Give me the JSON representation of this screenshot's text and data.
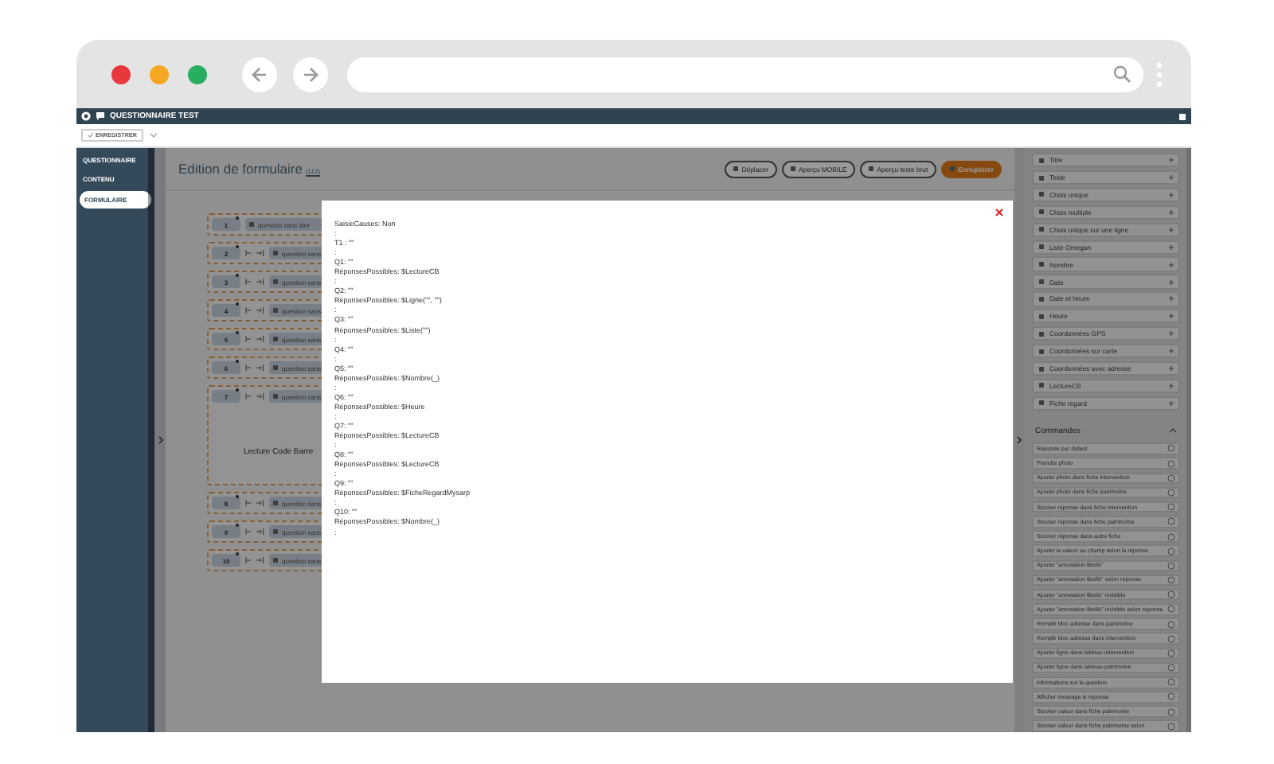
{
  "app_header": {
    "title": "QUESTIONNAIRE TEST"
  },
  "toolbar": {
    "save_label": "ENREGISTRER"
  },
  "sidebar": {
    "items": [
      {
        "label": "QUESTIONNAIRE",
        "selected": false
      },
      {
        "label": "CONTENU",
        "selected": false
      },
      {
        "label": "FORMULAIRE",
        "selected": true
      }
    ]
  },
  "editor": {
    "title": "Edition de formulaire",
    "count": "(112)",
    "buttons": [
      {
        "label": "Déplacer",
        "kind": "outline"
      },
      {
        "label": "Aperçu MOBILE",
        "kind": "outline"
      },
      {
        "label": "Aperçu texte brut",
        "kind": "outline"
      },
      {
        "label": "Enregistrer",
        "kind": "primary"
      }
    ],
    "questions": [
      {
        "number": "1",
        "label": "question sans titre",
        "kind": "title"
      },
      {
        "number": "2",
        "label": "question sans",
        "kind": "question"
      },
      {
        "number": "3",
        "label": "question sans",
        "kind": "question"
      },
      {
        "number": "4",
        "label": "question sans",
        "kind": "question"
      },
      {
        "number": "5",
        "label": "question sans",
        "kind": "question"
      },
      {
        "number": "6",
        "label": "question sans",
        "kind": "question"
      },
      {
        "number": "7",
        "label": "question sans",
        "kind": "barcode",
        "caption": "Lecture Code Barre"
      },
      {
        "number": "8",
        "label": "question sans",
        "kind": "question"
      },
      {
        "number": "9",
        "label": "question sans",
        "kind": "question"
      },
      {
        "number": "10",
        "label": "question sans",
        "kind": "question"
      }
    ]
  },
  "palette": {
    "items": [
      {
        "label": "Titre"
      },
      {
        "label": "Texte"
      },
      {
        "label": "Choix unique"
      },
      {
        "label": "Choix multiple"
      },
      {
        "label": "Choix unique sur une ligne"
      },
      {
        "label": "Liste Omegan"
      },
      {
        "label": "Nombre"
      },
      {
        "label": "Date"
      },
      {
        "label": "Date et heure"
      },
      {
        "label": "Heure"
      },
      {
        "label": "Coordonnées GPS"
      },
      {
        "label": "Coordonnées sur carte"
      },
      {
        "label": "Coordonnées avec adresse"
      },
      {
        "label": "LectureCB"
      },
      {
        "label": "Fiche regard"
      }
    ]
  },
  "commands": {
    "title": "Commandes",
    "items": [
      "Réponse par défaut",
      "Prendre photo",
      "Ajouter photo dans fiche intervention",
      "Ajouter photo dans fiche patrimoine",
      "Stocker réponse dans fiche intervention",
      "Stocker réponse dans fiche patrimoine",
      "Stocker réponse dans autre fiche",
      "Ajouter la valeur au champ selon la réponse",
      "Ajouter \"annotation libellé\"",
      "Ajouter \"annotation libellé\" selon réponse",
      "Ajouter \"annotation libellé\" invisible",
      "Ajouter \"annotation libellé\" invisible selon réponse",
      "Remplir bloc adresse dans patrimoine",
      "Remplir bloc adresse dans intervention",
      "Ajouter ligne dans tableau intervention",
      "Ajouter ligne dans tableau patrimoine",
      "Informations sur la question",
      "Afficher message si réponse",
      "Stocker valeur dans fiche patrimoine",
      "Stocker valeur dans fiche patrimoine selon"
    ]
  },
  "modal": {
    "lines": [
      "SaisieCauses: Non",
      ":",
      "T1 : \"\"",
      ":",
      "Q1: \"\"",
      "RéponsesPossibles: $LectureCB",
      ":",
      "Q2: \"\"",
      "RéponsesPossibles: $Ligne(\"\", \"\")",
      ":",
      "Q3: \"\"",
      "RéponsesPossibles: $Liste(\"\")",
      ":",
      "Q4: \"\"",
      ":",
      "Q5: \"\"",
      "RéponsesPossibles: $Nombre(_)",
      ":",
      "Q6: \"\"",
      "RéponsesPossibles: $Heure",
      ":",
      "Q7: \"\"",
      "RéponsesPossibles: $LectureCB",
      ":",
      "Q8: \"\"",
      "RéponsesPossibles: $LectureCB",
      ":",
      "Q9: \"\"",
      "RéponsesPossibles: $FicheRegardMysarp",
      ":",
      "Q10: \"\"",
      "RéponsesPossibles: $Nombre(_)",
      ":"
    ]
  }
}
